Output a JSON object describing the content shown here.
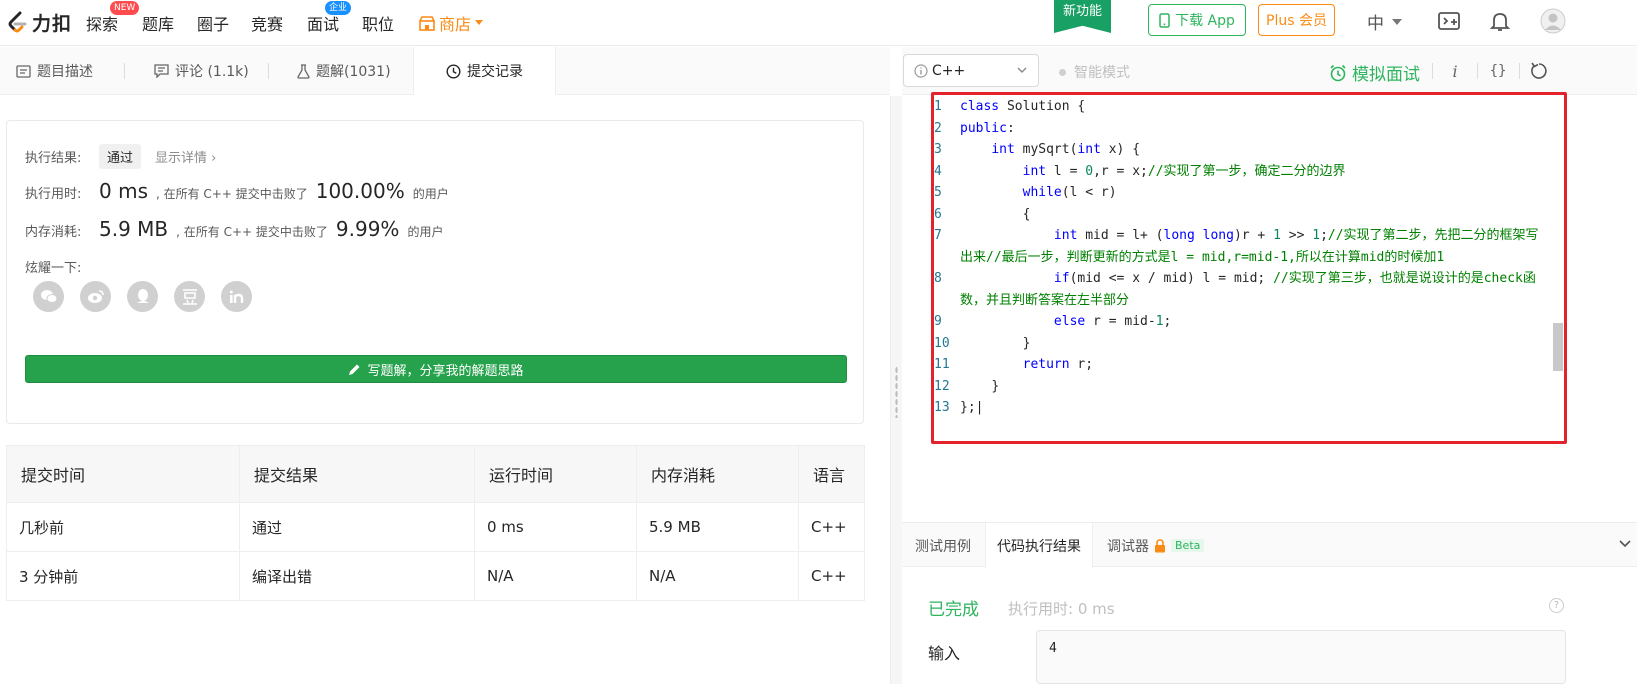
{
  "nav": {
    "logo_text": "力扣",
    "items": [
      {
        "label": "探索",
        "badge": "NEW"
      },
      {
        "label": "题库"
      },
      {
        "label": "圈子"
      },
      {
        "label": "竞赛"
      },
      {
        "label": "面试",
        "badge": "企业"
      },
      {
        "label": "职位"
      }
    ],
    "shop_label": "商店",
    "new_feature": "新功能",
    "download_app": "下载 App",
    "plus_member": "Plus 会员",
    "language": "中"
  },
  "left_tabs": [
    {
      "label": "题目描述"
    },
    {
      "label": "评论 (1.1k)"
    },
    {
      "label": "题解(1031)"
    },
    {
      "label": "提交记录"
    }
  ],
  "result": {
    "result_label": "执行结果:",
    "status": "通过",
    "details_link": "显示详情",
    "time_label": "执行用时:",
    "time_value": "0 ms",
    "time_text": ", 在所有 C++ 提交中击败了",
    "time_percent": "100.00%",
    "users_text": "的用户",
    "mem_label": "内存消耗:",
    "mem_value": "5.9 MB",
    "mem_text": ", 在所有 C++ 提交中击败了",
    "mem_percent": "9.99%",
    "mem_users_text": "的用户",
    "share_label": "炫耀一下:",
    "write_solution": "写题解，分享我的解题思路"
  },
  "submissions": {
    "headers": [
      "提交时间",
      "提交结果",
      "运行时间",
      "内存消耗",
      "语言"
    ],
    "rows": [
      {
        "time": "几秒前",
        "result": "通过",
        "runtime": "0 ms",
        "memory": "5.9 MB",
        "lang": "C++"
      },
      {
        "time": "3 分钟前",
        "result": "编译出错",
        "runtime": "N/A",
        "memory": "N/A",
        "lang": "C++"
      }
    ]
  },
  "editor": {
    "language": "C++",
    "smart_mode": "智能模式",
    "mock_interview": "模拟面试"
  },
  "bottom_tabs": [
    {
      "label": "测试用例"
    },
    {
      "label": "代码执行结果"
    },
    {
      "label": "调试器",
      "badge": "Beta"
    }
  ],
  "execution": {
    "status": "已完成",
    "time": "执行用时: 0 ms",
    "input_label": "输入",
    "input_value": "4"
  },
  "colors": {
    "accent_green": "#2db55d",
    "error_red": "#f04545",
    "shop_orange": "#fa8c16",
    "highlight_red": "#e3232b"
  }
}
